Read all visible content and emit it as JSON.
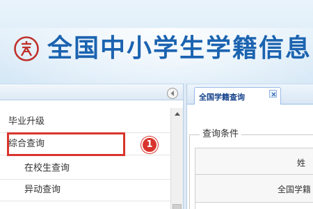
{
  "header": {
    "site_title": "全国中小学生学籍信息"
  },
  "nav": {
    "items": [
      {
        "label": "毕业升级"
      },
      {
        "label": "综合查询"
      },
      {
        "label": "在校生查询"
      },
      {
        "label": "异动查询"
      }
    ],
    "highlight_badge": "1"
  },
  "tabs": [
    {
      "label": "全国学籍查询"
    }
  ],
  "query": {
    "legend": "查询条件",
    "rows": [
      {
        "label": "姓"
      },
      {
        "label": "全国学籍"
      }
    ]
  },
  "colors": {
    "title": "#1b63b0",
    "highlight": "#d8342c",
    "header_bg": "#d4e7f6"
  }
}
